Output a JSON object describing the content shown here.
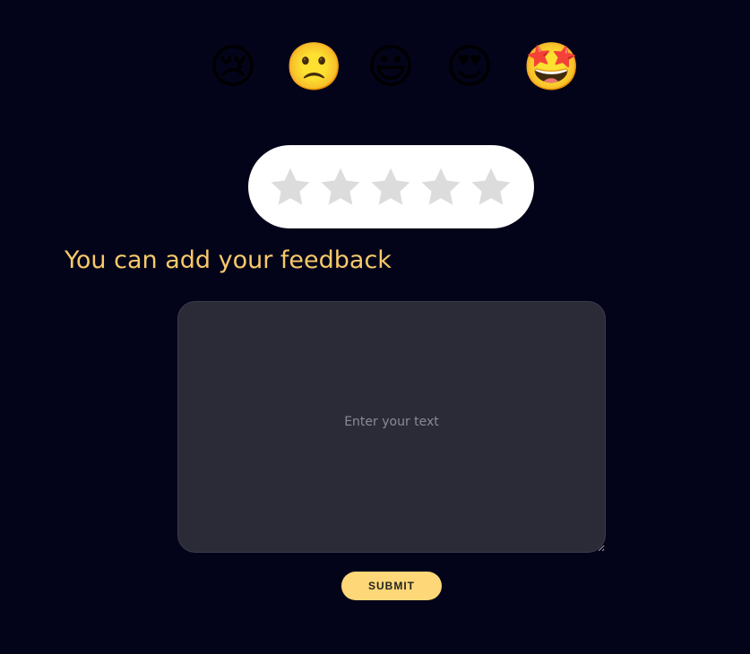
{
  "emojis": [
    {
      "glyph": "😢",
      "icon": "crying-face-icon"
    },
    {
      "glyph": "🙁",
      "icon": "frowning-face-icon"
    },
    {
      "glyph": "😃",
      "icon": "grinning-face-icon"
    },
    {
      "glyph": "😍",
      "icon": "heart-eyes-face-icon"
    },
    {
      "glyph": "🤩",
      "icon": "star-struck-face-icon"
    }
  ],
  "rating": {
    "max": 5,
    "value": 0,
    "star_icon": "star-icon",
    "star_color": "#dcdcdc"
  },
  "feedback": {
    "heading": "You can add your feedback",
    "placeholder": "Enter your text",
    "value": ""
  },
  "submit": {
    "label": "SUBMIT"
  },
  "colors": {
    "background": "#03041a",
    "accent": "#fdd778",
    "heading": "#f7c96a",
    "textarea_bg": "#2b2b38"
  }
}
